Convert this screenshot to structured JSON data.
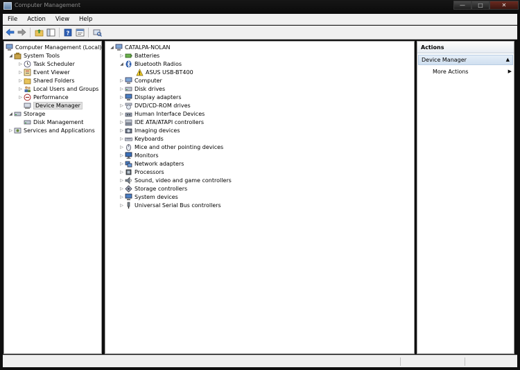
{
  "window": {
    "title": "Computer Management"
  },
  "menu": [
    "File",
    "Action",
    "View",
    "Help"
  ],
  "left_tree": [
    {
      "label": "Computer Management (Local)",
      "level": 0,
      "arrow": "",
      "icon": "computer-management-icon"
    },
    {
      "label": "System Tools",
      "level": 1,
      "arrow": "◢",
      "icon": "tools-icon"
    },
    {
      "label": "Task Scheduler",
      "level": 2,
      "arrow": "▷",
      "icon": "clock-icon"
    },
    {
      "label": "Event Viewer",
      "level": 2,
      "arrow": "▷",
      "icon": "event-viewer-icon"
    },
    {
      "label": "Shared Folders",
      "level": 2,
      "arrow": "▷",
      "icon": "folder-icon"
    },
    {
      "label": "Local Users and Groups",
      "level": 2,
      "arrow": "▷",
      "icon": "users-icon"
    },
    {
      "label": "Performance",
      "level": 2,
      "arrow": "▷",
      "icon": "performance-icon"
    },
    {
      "label": "Device Manager",
      "level": 2,
      "arrow": "",
      "icon": "device-manager-icon",
      "selected": true
    },
    {
      "label": "Storage",
      "level": 1,
      "arrow": "◢",
      "icon": "storage-icon"
    },
    {
      "label": "Disk Management",
      "level": 2,
      "arrow": "",
      "icon": "disk-icon"
    },
    {
      "label": "Services and Applications",
      "level": 1,
      "arrow": "▷",
      "icon": "services-icon"
    }
  ],
  "device_tree": {
    "root": "CATALPA-NOLAN",
    "items": [
      {
        "label": "Batteries",
        "arrow": "▷",
        "icon": "battery-icon"
      },
      {
        "label": "Bluetooth Radios",
        "arrow": "◢",
        "icon": "bluetooth-icon"
      },
      {
        "label": "ASUS USB-BT400",
        "arrow": "",
        "icon": "warning-icon",
        "child": true
      },
      {
        "label": "Computer",
        "arrow": "▷",
        "icon": "computer-icon"
      },
      {
        "label": "Disk drives",
        "arrow": "▷",
        "icon": "disk-drive-icon"
      },
      {
        "label": "Display adapters",
        "arrow": "▷",
        "icon": "display-adapter-icon"
      },
      {
        "label": "DVD/CD-ROM drives",
        "arrow": "▷",
        "icon": "dvd-icon"
      },
      {
        "label": "Human Interface Devices",
        "arrow": "▷",
        "icon": "hid-icon"
      },
      {
        "label": "IDE ATA/ATAPI controllers",
        "arrow": "▷",
        "icon": "ide-icon"
      },
      {
        "label": "Imaging devices",
        "arrow": "▷",
        "icon": "camera-icon"
      },
      {
        "label": "Keyboards",
        "arrow": "▷",
        "icon": "keyboard-icon"
      },
      {
        "label": "Mice and other pointing devices",
        "arrow": "▷",
        "icon": "mouse-icon"
      },
      {
        "label": "Monitors",
        "arrow": "▷",
        "icon": "monitor-icon"
      },
      {
        "label": "Network adapters",
        "arrow": "▷",
        "icon": "network-icon"
      },
      {
        "label": "Processors",
        "arrow": "▷",
        "icon": "processor-icon"
      },
      {
        "label": "Sound, video and game controllers",
        "arrow": "▷",
        "icon": "sound-icon"
      },
      {
        "label": "Storage controllers",
        "arrow": "▷",
        "icon": "storage-controller-icon"
      },
      {
        "label": "System devices",
        "arrow": "▷",
        "icon": "system-devices-icon"
      },
      {
        "label": "Universal Serial Bus controllers",
        "arrow": "▷",
        "icon": "usb-icon"
      }
    ]
  },
  "actions": {
    "header": "Actions",
    "section": "Device Manager",
    "more": "More Actions"
  }
}
